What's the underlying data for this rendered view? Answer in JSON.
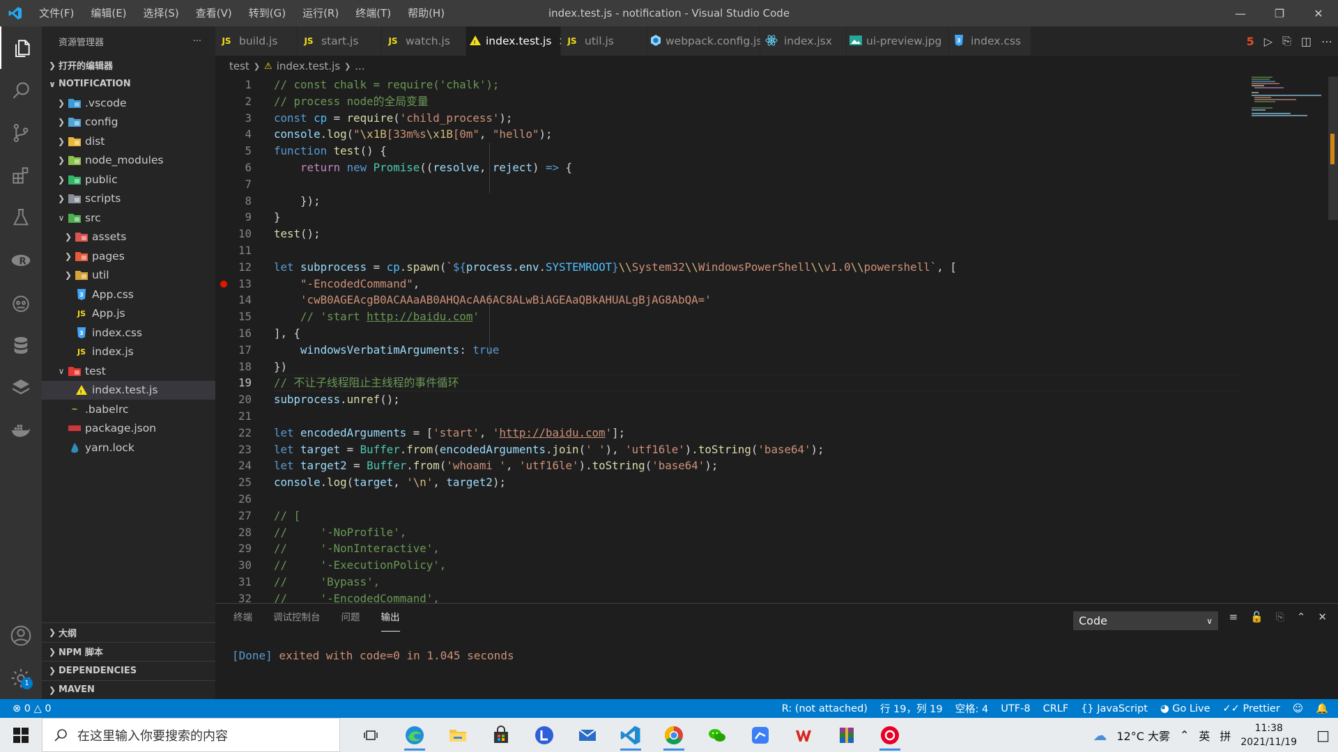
{
  "window": {
    "title": "index.test.js - notification - Visual Studio Code",
    "menu": [
      "文件(F)",
      "编辑(E)",
      "选择(S)",
      "查看(V)",
      "转到(G)",
      "运行(R)",
      "终端(T)",
      "帮助(H)"
    ]
  },
  "activity": {
    "items": [
      "explorer-icon",
      "search-icon",
      "source-control-icon",
      "extensions-icon",
      "testing-icon",
      "remote-icon",
      "robot-icon",
      "database-icon",
      "layers-icon",
      "docker-icon"
    ],
    "settings_badge": "1"
  },
  "sidebar": {
    "title": "资源管理器",
    "more": "···",
    "open_editors": "打开的编辑器",
    "project": "NOTIFICATION",
    "tree": [
      {
        "label": ".vscode",
        "type": "folder",
        "level": 0,
        "open": false,
        "icon": "folder-vscode",
        "color": "#3e9bd8"
      },
      {
        "label": "config",
        "type": "folder",
        "level": 0,
        "open": false,
        "icon": "folder-config",
        "color": "#4fa5d8"
      },
      {
        "label": "dist",
        "type": "folder",
        "level": 0,
        "open": false,
        "icon": "folder-dist",
        "color": "#e7b83a"
      },
      {
        "label": "node_modules",
        "type": "folder",
        "level": 0,
        "open": false,
        "icon": "folder-node",
        "color": "#8bc34a"
      },
      {
        "label": "public",
        "type": "folder",
        "level": 0,
        "open": false,
        "icon": "folder-public",
        "color": "#30b868"
      },
      {
        "label": "scripts",
        "type": "folder",
        "level": 0,
        "open": false,
        "icon": "folder-scripts",
        "color": "#8a8f98"
      },
      {
        "label": "src",
        "type": "folder",
        "level": 0,
        "open": true,
        "icon": "folder-src",
        "color": "#4caf50"
      },
      {
        "label": "assets",
        "type": "folder",
        "level": 1,
        "open": false,
        "icon": "folder-assets",
        "color": "#d9534f"
      },
      {
        "label": "pages",
        "type": "folder",
        "level": 1,
        "open": false,
        "icon": "folder-pages",
        "color": "#e55b3c"
      },
      {
        "label": "util",
        "type": "folder",
        "level": 1,
        "open": false,
        "icon": "folder-util",
        "color": "#d4a13a"
      },
      {
        "label": "App.css",
        "type": "file",
        "level": 1,
        "icon": "css",
        "color": "#42a5f5"
      },
      {
        "label": "App.js",
        "type": "file",
        "level": 1,
        "icon": "js",
        "color": "#f5de19"
      },
      {
        "label": "index.css",
        "type": "file",
        "level": 1,
        "icon": "css",
        "color": "#42a5f5"
      },
      {
        "label": "index.js",
        "type": "file",
        "level": 1,
        "icon": "js",
        "color": "#f5de19"
      },
      {
        "label": "test",
        "type": "folder",
        "level": 0,
        "open": true,
        "icon": "folder-test",
        "color": "#e53935"
      },
      {
        "label": "index.test.js",
        "type": "file",
        "level": 1,
        "icon": "test-js",
        "color": "#f5de19",
        "selected": true
      },
      {
        "label": ".babelrc",
        "type": "file",
        "level": -1,
        "icon": "babel",
        "color": "#e8c547"
      },
      {
        "label": "package.json",
        "type": "file",
        "level": -1,
        "icon": "npm",
        "color": "#cb3837"
      },
      {
        "label": "yarn.lock",
        "type": "file",
        "level": -1,
        "icon": "yarn",
        "color": "#2c8ebb"
      }
    ],
    "bottom_sections": [
      "大纲",
      "NPM 脚本",
      "DEPENDENCIES",
      "MAVEN"
    ]
  },
  "tabs": [
    {
      "label": "build.js",
      "icon": "JS",
      "color": "#f5de19"
    },
    {
      "label": "start.js",
      "icon": "JS",
      "color": "#f5de19"
    },
    {
      "label": "watch.js",
      "icon": "JS",
      "color": "#f5de19"
    },
    {
      "label": "index.test.js",
      "icon": "test-js",
      "color": "#f5de19",
      "active": true
    },
    {
      "label": "util.js",
      "icon": "JS",
      "color": "#f5de19"
    },
    {
      "label": "webpack.config.js",
      "icon": "webpack",
      "color": "#8ed6fb"
    },
    {
      "label": "index.jsx",
      "icon": "react",
      "color": "#61dafb"
    },
    {
      "label": "ui-preview.jpg",
      "icon": "image",
      "color": "#26a69a"
    },
    {
      "label": "index.css",
      "icon": "css",
      "color": "#42a5f5"
    }
  ],
  "breadcrumb": [
    "test",
    "index.test.js",
    "..."
  ],
  "editor": {
    "current_line": 19,
    "breakpoint_line": 13,
    "lines": [
      [
        [
          "c-com",
          "// const chalk = require('chalk');"
        ]
      ],
      [
        [
          "c-com",
          "// process node的全局变量"
        ]
      ],
      [
        [
          "c-kw",
          "const "
        ],
        [
          "c-const",
          "cp"
        ],
        [
          "c-p",
          " = "
        ],
        [
          "c-fn",
          "require"
        ],
        [
          "c-p",
          "("
        ],
        [
          "c-str",
          "'child_process'"
        ],
        [
          "c-p",
          ");"
        ]
      ],
      [
        [
          "c-var",
          "console"
        ],
        [
          "c-p",
          "."
        ],
        [
          "c-fn",
          "log"
        ],
        [
          "c-p",
          "("
        ],
        [
          "c-str",
          "\""
        ],
        [
          "c-esc",
          "\\x1B"
        ],
        [
          "c-str",
          "[33m%s"
        ],
        [
          "c-esc",
          "\\x1B"
        ],
        [
          "c-str",
          "[0m\""
        ],
        [
          "c-p",
          ", "
        ],
        [
          "c-str",
          "\"hello\""
        ],
        [
          "c-p",
          ");"
        ]
      ],
      [
        [
          "c-kw",
          "function "
        ],
        [
          "c-fn",
          "test"
        ],
        [
          "c-p",
          "() {"
        ]
      ],
      [
        [
          "c-p",
          "    "
        ],
        [
          "c-ctl",
          "return "
        ],
        [
          "c-kw",
          "new "
        ],
        [
          "c-cls",
          "Promise"
        ],
        [
          "c-p",
          "(("
        ],
        [
          "c-var",
          "resolve"
        ],
        [
          "c-p",
          ", "
        ],
        [
          "c-var",
          "reject"
        ],
        [
          "c-p",
          ") "
        ],
        [
          "c-kw",
          "=>"
        ],
        [
          "c-p",
          " {"
        ]
      ],
      [
        [
          "c-p",
          ""
        ]
      ],
      [
        [
          "c-p",
          "    });"
        ]
      ],
      [
        [
          "c-p",
          "}"
        ]
      ],
      [
        [
          "c-fn",
          "test"
        ],
        [
          "c-p",
          "();"
        ]
      ],
      [
        [
          "c-p",
          ""
        ]
      ],
      [
        [
          "c-kw",
          "let "
        ],
        [
          "c-var",
          "subprocess"
        ],
        [
          "c-p",
          " = "
        ],
        [
          "c-const",
          "cp"
        ],
        [
          "c-p",
          "."
        ],
        [
          "c-fn",
          "spawn"
        ],
        [
          "c-p",
          "("
        ],
        [
          "c-str",
          "`"
        ],
        [
          "c-kw",
          "${"
        ],
        [
          "c-var",
          "process"
        ],
        [
          "c-p",
          "."
        ],
        [
          "c-var",
          "env"
        ],
        [
          "c-p",
          "."
        ],
        [
          "c-const",
          "SYSTEMROOT"
        ],
        [
          "c-kw",
          "}"
        ],
        [
          "c-esc",
          "\\\\"
        ],
        [
          "c-str",
          "System32"
        ],
        [
          "c-esc",
          "\\\\"
        ],
        [
          "c-str",
          "WindowsPowerShell"
        ],
        [
          "c-esc",
          "\\\\"
        ],
        [
          "c-str",
          "v1.0"
        ],
        [
          "c-esc",
          "\\\\"
        ],
        [
          "c-str",
          "powershell`"
        ],
        [
          "c-p",
          ", ["
        ]
      ],
      [
        [
          "c-p",
          "    "
        ],
        [
          "c-str",
          "\"-EncodedCommand\""
        ],
        [
          "c-p",
          ","
        ]
      ],
      [
        [
          "c-p",
          "    "
        ],
        [
          "c-str",
          "'cwB0AGEAcgB0ACAAaAB0AHQAcAA6AC8ALwBiAGEAaQBkAHUALgBjAG8AbQA='"
        ]
      ],
      [
        [
          "c-p",
          "    "
        ],
        [
          "c-com",
          "// 'start "
        ],
        [
          "c-com c-url",
          "http://baidu.com"
        ],
        [
          "c-com",
          "'"
        ]
      ],
      [
        [
          "c-p",
          "], {"
        ]
      ],
      [
        [
          "c-p",
          "    "
        ],
        [
          "c-var",
          "windowsVerbatimArguments"
        ],
        [
          "c-p",
          ": "
        ],
        [
          "c-kw",
          "true"
        ]
      ],
      [
        [
          "c-p",
          "})"
        ]
      ],
      [
        [
          "c-com",
          "// 不让子线程阻止主线程的事件循环"
        ]
      ],
      [
        [
          "c-var",
          "subprocess"
        ],
        [
          "c-p",
          "."
        ],
        [
          "c-fn",
          "unref"
        ],
        [
          "c-p",
          "();"
        ]
      ],
      [
        [
          "c-p",
          ""
        ]
      ],
      [
        [
          "c-kw",
          "let "
        ],
        [
          "c-var",
          "encodedArguments"
        ],
        [
          "c-p",
          " = ["
        ],
        [
          "c-str",
          "'start'"
        ],
        [
          "c-p",
          ", "
        ],
        [
          "c-str",
          "'"
        ],
        [
          "c-str c-url",
          "http://baidu.com"
        ],
        [
          "c-str",
          "'"
        ],
        [
          "c-p",
          "];"
        ]
      ],
      [
        [
          "c-kw",
          "let "
        ],
        [
          "c-var",
          "target"
        ],
        [
          "c-p",
          " = "
        ],
        [
          "c-cls",
          "Buffer"
        ],
        [
          "c-p",
          "."
        ],
        [
          "c-fn",
          "from"
        ],
        [
          "c-p",
          "("
        ],
        [
          "c-var",
          "encodedArguments"
        ],
        [
          "c-p",
          "."
        ],
        [
          "c-fn",
          "join"
        ],
        [
          "c-p",
          "("
        ],
        [
          "c-str",
          "' '"
        ],
        [
          "c-p",
          "), "
        ],
        [
          "c-str",
          "'utf16le'"
        ],
        [
          "c-p",
          ")."
        ],
        [
          "c-fn",
          "toString"
        ],
        [
          "c-p",
          "("
        ],
        [
          "c-str",
          "'base64'"
        ],
        [
          "c-p",
          ");"
        ]
      ],
      [
        [
          "c-kw",
          "let "
        ],
        [
          "c-var",
          "target2"
        ],
        [
          "c-p",
          " = "
        ],
        [
          "c-cls",
          "Buffer"
        ],
        [
          "c-p",
          "."
        ],
        [
          "c-fn",
          "from"
        ],
        [
          "c-p",
          "("
        ],
        [
          "c-str",
          "'whoami '"
        ],
        [
          "c-p",
          ", "
        ],
        [
          "c-str",
          "'utf16le'"
        ],
        [
          "c-p",
          ")."
        ],
        [
          "c-fn",
          "toString"
        ],
        [
          "c-p",
          "("
        ],
        [
          "c-str",
          "'base64'"
        ],
        [
          "c-p",
          ");"
        ]
      ],
      [
        [
          "c-var",
          "console"
        ],
        [
          "c-p",
          "."
        ],
        [
          "c-fn",
          "log"
        ],
        [
          "c-p",
          "("
        ],
        [
          "c-var",
          "target"
        ],
        [
          "c-p",
          ", "
        ],
        [
          "c-str",
          "'"
        ],
        [
          "c-esc",
          "\\n"
        ],
        [
          "c-str",
          "'"
        ],
        [
          "c-p",
          ", "
        ],
        [
          "c-var",
          "target2"
        ],
        [
          "c-p",
          ");"
        ]
      ],
      [
        [
          "c-p",
          ""
        ]
      ],
      [
        [
          "c-com",
          "// ["
        ]
      ],
      [
        [
          "c-com",
          "//     '-NoProfile',"
        ]
      ],
      [
        [
          "c-com",
          "//     '-NonInteractive',"
        ]
      ],
      [
        [
          "c-com",
          "//     '-ExecutionPolicy',"
        ]
      ],
      [
        [
          "c-com",
          "//     'Bypass',"
        ]
      ],
      [
        [
          "c-com",
          "//     '-EncodedCommand',"
        ]
      ]
    ]
  },
  "panel": {
    "tabs": [
      "终端",
      "调试控制台",
      "问题",
      "输出"
    ],
    "active_tab": "输出",
    "channel": "Code",
    "output_done": "[Done]",
    "output_rest": " exited with code=0 in 1.045 seconds"
  },
  "statusbar": {
    "errors": "0",
    "warnings": "0",
    "r_status": "R: (not attached)",
    "position": "行 19，列 19",
    "indent": "空格: 4",
    "encoding": "UTF-8",
    "eol": "CRLF",
    "language": "JavaScript",
    "golive": "Go Live",
    "prettier": "Prettier"
  },
  "taskbar": {
    "search_placeholder": "在这里输入你要搜索的内容",
    "apps": [
      "task-view-icon",
      "edge-icon",
      "file-explorer-icon",
      "store-icon",
      "lark-icon",
      "mail-icon",
      "vscode-icon",
      "chrome-icon",
      "wechat-icon",
      "feishu-icon",
      "wps-icon",
      "winrar-icon",
      "netease-music-icon"
    ],
    "weather": "12°C 大雾",
    "ime_lang": "英",
    "ime_mode": "拼",
    "time": "11:38",
    "date": "2021/11/19"
  }
}
